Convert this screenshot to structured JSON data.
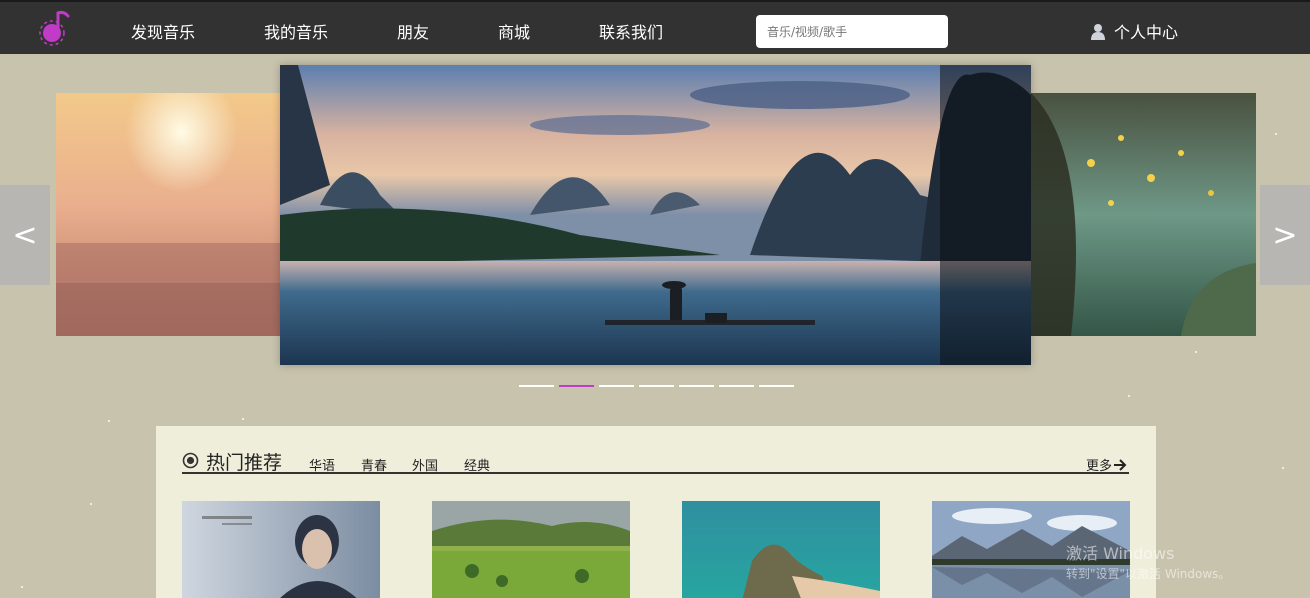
{
  "nav": {
    "items": [
      {
        "id": "discover",
        "label": "发现音乐"
      },
      {
        "id": "mymusic",
        "label": "我的音乐"
      },
      {
        "id": "friends",
        "label": "朋友"
      },
      {
        "id": "store",
        "label": "商城"
      },
      {
        "id": "contact",
        "label": "联系我们"
      }
    ],
    "search_placeholder": "音乐/视频/歌手",
    "user_label": "个人中心",
    "logo_icon": "music-note-logo-icon",
    "user_icon": "person-icon"
  },
  "carousel": {
    "prev_label": "<",
    "next_label": ">",
    "slide_count": 7,
    "active_index": 1,
    "slides": [
      {
        "position": "left",
        "description": "sunset-city"
      },
      {
        "position": "center",
        "description": "river-karst-fisherman"
      },
      {
        "position": "right",
        "description": "glowing-tree-forest"
      }
    ]
  },
  "hot": {
    "title": "热门推荐",
    "tags": [
      "华语",
      "青春",
      "外国",
      "经典"
    ],
    "more_label": "更多",
    "cards": [
      {
        "description": "singer-portrait"
      },
      {
        "description": "green-village"
      },
      {
        "description": "turquoise-island"
      },
      {
        "description": "mountain-lake"
      }
    ]
  },
  "watermark": {
    "line1": "激活 Windows",
    "line2": "转到\"设置\"以激活 Windows。"
  },
  "colors": {
    "topbar": "#333232",
    "page_bg": "#c8c3ad",
    "panel_bg": "#efeedb",
    "accent": "#c23ac8"
  }
}
